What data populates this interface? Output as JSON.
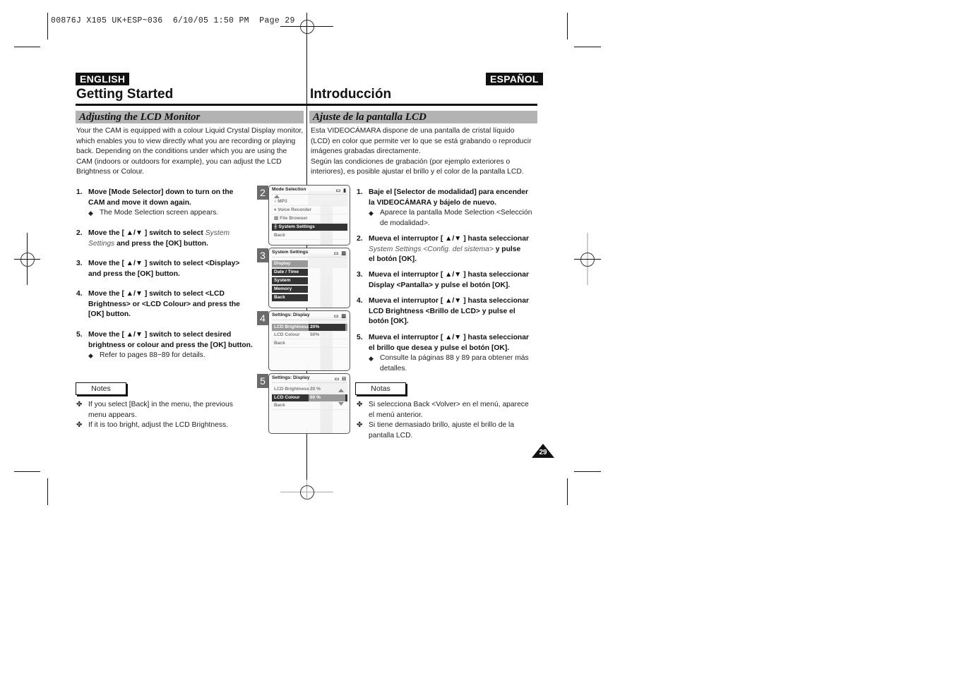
{
  "slug": "00876J X105 UK+ESP~036  6/10/05 1:50 PM  Page 29",
  "english": {
    "lang_label": "ENGLISH",
    "chapter_title": "Getting Started",
    "section_title": "Adjusting the LCD Monitor",
    "intro": [
      "Your the CAM is equipped with a colour Liquid Crystal Display monitor,",
      "which enables you to view directly what you are recording or playing",
      "back. Depending on the conditions under which you are using the",
      "CAM (indoors or outdoors for example), you can adjust the LCD",
      "Brightness or Colour."
    ],
    "steps": [
      {
        "num": "1.",
        "lines": [
          "Move [Mode Selector] down to turn on the",
          "CAM and move it down again."
        ],
        "bullet": [
          "The Mode Selection screen appears."
        ]
      },
      {
        "num": "2.",
        "pre": "Move the [ ▲/▼ ] switch to select ",
        "italic": "System",
        "line2_italic": "Settings",
        "line2_rest": " and press the [OK] button."
      },
      {
        "num": "3.",
        "lines": [
          "Move the [ ▲/▼ ] switch to select <Display>",
          "and press the [OK] button."
        ]
      },
      {
        "num": "4.",
        "lines": [
          "Move the [ ▲/▼ ] switch to select <LCD",
          "Brightness> or <LCD Colour> and press the",
          "[OK] button."
        ]
      },
      {
        "num": "5.",
        "lines": [
          "Move the [ ▲/▼ ] switch to select desired",
          "brightness or colour and press the [OK] button."
        ],
        "bullet": [
          "Refer to pages 88~89 for details."
        ]
      }
    ],
    "notes_label": "Notes",
    "notes": [
      [
        "If you select [Back] in the menu, the previous",
        "menu appears."
      ],
      [
        "If it is too bright, adjust the LCD Brightness."
      ]
    ]
  },
  "espanol": {
    "lang_label": "ESPAÑOL",
    "chapter_title": "Introducción",
    "section_title": "Ajuste de la pantalla LCD",
    "intro": [
      "Esta VIDEOCÁMARA dispone de una pantalla de cristal líquido",
      "(LCD) en color que permite ver lo que se está grabando o reproducir",
      "imágenes grabadas directamente.",
      "Según las condiciones de grabación (por ejemplo exteriores o",
      "interiores), es posible ajustar el brillo y el color de la pantalla LCD."
    ],
    "steps": [
      {
        "num": "1.",
        "lines": [
          "Baje el [Selector de modalidad] para encender",
          "la VIDEOCÁMARA y bájelo de nuevo."
        ],
        "bullet": [
          "Aparece la pantalla Mode Selection <Selección",
          "de modalidad>."
        ]
      },
      {
        "num": "2.",
        "line1": "Mueva el interruptor [ ▲/▼ ] hasta seleccionar",
        "line2_italic": "System Settings <Config. del sistema>",
        "line2_rest": " y pulse",
        "line3": "el botón [OK]."
      },
      {
        "num": "3.",
        "lines": [
          "Mueva el interruptor [ ▲/▼ ] hasta seleccionar",
          "Display <Pantalla> y pulse el botón [OK]."
        ]
      },
      {
        "num": "4.",
        "lines": [
          "Mueva el interruptor [ ▲/▼ ] hasta seleccionar",
          "LCD Brightness <Brillo de LCD> y pulse el",
          "botón [OK]."
        ]
      },
      {
        "num": "5.",
        "lines": [
          "Mueva el interruptor [ ▲/▼ ] hasta seleccionar",
          "el brillo que desea y pulse el botón [OK]."
        ],
        "bullet": [
          "Consulte la páginas 88 y 89 para obtener más",
          "detalles."
        ]
      }
    ],
    "notes_label": "Notas",
    "notes": [
      [
        "Si selecciona Back <Volver> en el menú, aparece",
        "el menú anterior."
      ],
      [
        "Si tiene demasiado brillo, ajuste el brillo de la",
        "pantalla LCD."
      ]
    ]
  },
  "screens": [
    {
      "num": "2",
      "title": "Mode Selection",
      "items": [
        "MP3",
        "Voice Recorder",
        "File Browser",
        "System Settings",
        "Back"
      ],
      "selected": "System Settings"
    },
    {
      "num": "3",
      "title": "System Settings",
      "items": [
        "Display",
        "Date / Time",
        "System",
        "Memory",
        "Back"
      ],
      "selected": "Display"
    },
    {
      "num": "4",
      "title": "Settings: Display",
      "items": [
        {
          "label": "LCD Brightness",
          "value": "20%"
        },
        {
          "label": "LCD Colour",
          "value": "50%"
        },
        {
          "label": "Back",
          "value": ""
        }
      ],
      "selected": "LCD Brightness"
    },
    {
      "num": "5",
      "title": "Settings: Display",
      "items": [
        {
          "label": "LCD Brightness",
          "value": "20 %"
        },
        {
          "label": "LCD Colour",
          "value": "60 %"
        },
        {
          "label": "Back",
          "value": ""
        }
      ],
      "selected": "LCD Colour"
    }
  ],
  "page_number": "29",
  "symbols": {
    "bullet": "◆",
    "note": "✤"
  }
}
